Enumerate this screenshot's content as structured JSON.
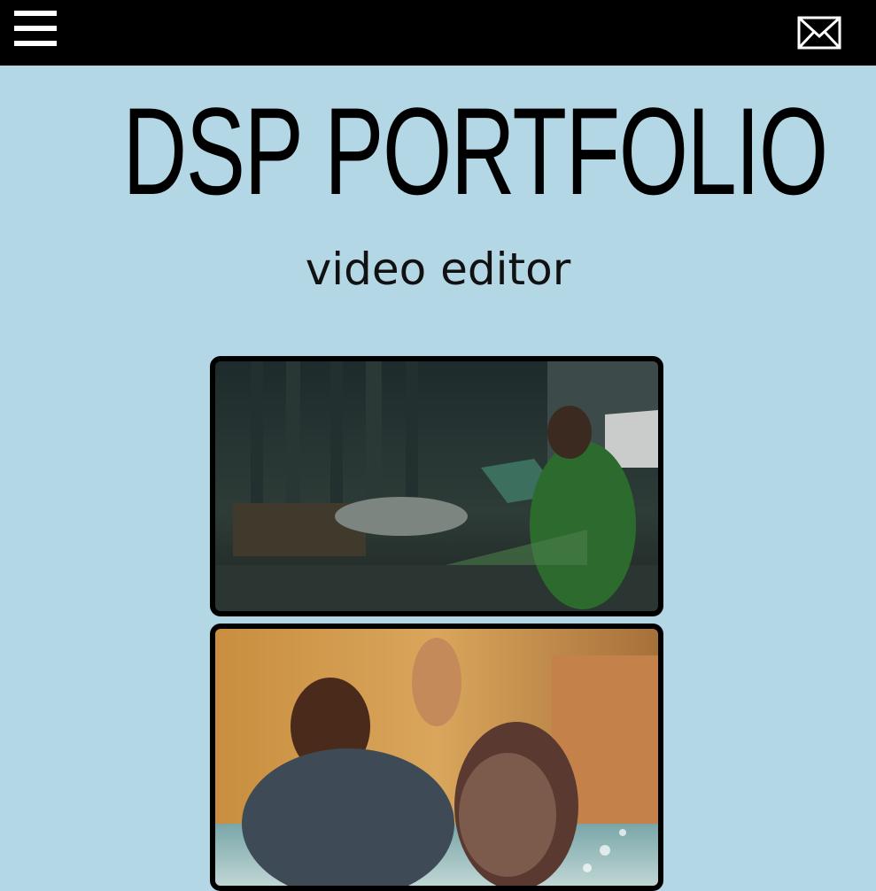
{
  "header": {
    "menu_icon": "hamburger-menu-icon",
    "mail_icon": "envelope-icon",
    "background": "#000000"
  },
  "hero": {
    "title": "DSP PORTFOLIO",
    "subtitle": "video editor"
  },
  "videos": [
    {
      "name": "street-scene-clip"
    },
    {
      "name": "pool-scene-clip"
    }
  ],
  "colors": {
    "page_background": "#b3d7e5",
    "text": "#000000"
  }
}
